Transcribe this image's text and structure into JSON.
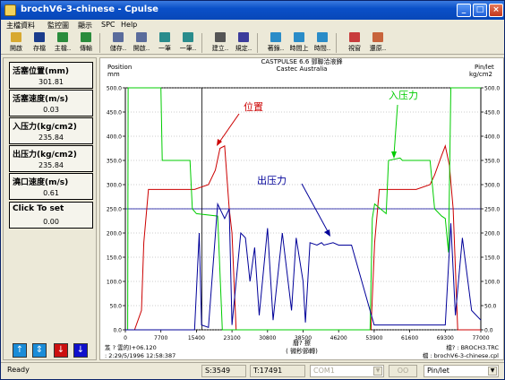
{
  "window": {
    "title": "brochV6-3-chinese - Cpulse",
    "controls": [
      "_",
      "□",
      "×"
    ]
  },
  "menu": [
    "主檔資料",
    "監控圖",
    "顯示",
    "SPC",
    "Help"
  ],
  "toolbar": [
    {
      "label": "開啟",
      "icon": "folder-open-icon",
      "color": "#d8a930"
    },
    {
      "label": "存檔",
      "icon": "floppy-disk-icon",
      "color": "#1a3c8c"
    },
    {
      "label": "主檔..",
      "icon": "database-icon",
      "color": "#2a8c3c"
    },
    {
      "label": "傳輸",
      "icon": "transfer-icon",
      "color": "#2a8c3c"
    },
    {
      "label": "儲存..",
      "icon": "save-icon",
      "color": "#5a6c9c"
    },
    {
      "label": "開啟..",
      "icon": "open-icon",
      "color": "#5a6c9c"
    },
    {
      "label": "一筆",
      "icon": "previous-icon",
      "color": "#2a8c8c"
    },
    {
      "label": "一筆..",
      "icon": "next-icon",
      "color": "#2a8c8c"
    },
    {
      "label": "建立..",
      "icon": "wrench-icon",
      "color": "#555555"
    },
    {
      "label": "規定..",
      "icon": "spec-icon",
      "color": "#3c3c9c"
    },
    {
      "label": "著錄..",
      "icon": "record-icon",
      "color": "#2a8cc8"
    },
    {
      "label": "時間上",
      "icon": "time-up-icon",
      "color": "#2a8cc8"
    },
    {
      "label": "時間..",
      "icon": "time-icon",
      "color": "#2a8cc8"
    },
    {
      "label": "視窗",
      "icon": "window-icon",
      "color": "#c83c3c"
    },
    {
      "label": "還原..",
      "icon": "restore-icon",
      "color": "#c8643c"
    }
  ],
  "values": [
    {
      "label": "活塞位置(mm)",
      "value": "301.81"
    },
    {
      "label": "活塞速度(m/s)",
      "value": "0.03"
    },
    {
      "label": "入压力(kg/cm2)",
      "value": "235.84"
    },
    {
      "label": "出压力(kg/cm2)",
      "value": "235.84"
    },
    {
      "label": "澆口速度(m/s)",
      "value": "0.61"
    },
    {
      "label": "Click To set",
      "value": "0.00"
    }
  ],
  "chart": {
    "header_line1": "CASTPULSE 6.6   鄧聯洽液鋒",
    "header_line2": "Castec Australia",
    "left_axis_title1": "Position",
    "left_axis_title2": "mm",
    "right_axis_title1": "Pin/let",
    "right_axis_title2": "kg/cm2",
    "annotation_position": "位置",
    "annotation_in_pressure": "入压力",
    "annotation_out_pressure": "出压力",
    "x_axis_title": "曆? 擦",
    "x_axis_subtitle": "(   微秒節轉)",
    "footer_left1": "笈    ?   雲的)+06.120",
    "footer_left2": ": 2:29/5/1996 12:58:387",
    "footer_right1": "檔? : BROCH3.TRC",
    "footer_right2": "檔    : brochV6-3-chinese.cpl",
    "colors": {
      "position": "#cc0000",
      "in_pressure": "#00cc00",
      "out_pressure": "#000099"
    }
  },
  "chart_data": {
    "type": "line",
    "title": "CASTPULSE 6.6",
    "x_ticks": [
      0,
      7700,
      15400,
      23100,
      30800,
      38500,
      46200,
      53900,
      61600,
      69300,
      77000
    ],
    "y_ticks_left": [
      0,
      50,
      100,
      150,
      200,
      250,
      300,
      350,
      400,
      450,
      500
    ],
    "y_ticks_right": [
      0,
      50,
      100,
      150,
      200,
      250,
      300,
      350,
      400,
      450,
      500
    ],
    "xlim": [
      0,
      77000
    ],
    "ylim": [
      0,
      500
    ],
    "series": [
      {
        "color": "#cc0000",
        "x": [
          0,
          2000,
          3500,
          4000,
          5000,
          7700,
          10000,
          15000,
          18000,
          19500,
          20500,
          21500,
          22500,
          23100,
          24000,
          30800,
          46200,
          52000,
          53200,
          54000,
          55000,
          58000,
          63000,
          66000,
          67000,
          68500,
          69300,
          70200,
          71000,
          72000,
          77000
        ],
        "values": [
          0,
          0,
          40,
          180,
          290,
          290,
          290,
          290,
          300,
          330,
          375,
          380,
          250,
          200,
          0,
          0,
          0,
          0,
          0,
          180,
          290,
          290,
          290,
          300,
          320,
          360,
          380,
          340,
          250,
          0,
          0
        ]
      },
      {
        "color": "#00cc00",
        "x": [
          0,
          500,
          600,
          3500,
          5000,
          7700,
          8000,
          14000,
          14500,
          15400,
          20000,
          21000,
          22000,
          23100,
          30800,
          46200,
          53000,
          53500,
          54000,
          56500,
          57000,
          59500,
          60000,
          66000,
          67000,
          68500,
          69300,
          70000,
          70500,
          77000
        ],
        "values": [
          0,
          0,
          500,
          500,
          500,
          500,
          350,
          350,
          250,
          240,
          235,
          0,
          0,
          0,
          0,
          0,
          0,
          230,
          260,
          240,
          350,
          355,
          350,
          350,
          250,
          235,
          230,
          160,
          500,
          500
        ]
      },
      {
        "color": "#000099",
        "x": [
          0,
          7700,
          12000,
          15000,
          16000,
          16500,
          18000,
          20000,
          21500,
          22500,
          23100,
          25000,
          26000,
          27000,
          28000,
          29000,
          30800,
          32000,
          34000,
          36000,
          37000,
          38500,
          39000,
          40000,
          41500,
          42500,
          43000,
          45000,
          46200,
          49000,
          53900,
          61600,
          64000,
          66000,
          68000,
          69300,
          70500,
          71500,
          73000,
          75000,
          77000
        ],
        "values": [
          0,
          0,
          0,
          0,
          200,
          10,
          5,
          260,
          230,
          250,
          10,
          200,
          190,
          100,
          170,
          30,
          210,
          20,
          200,
          40,
          190,
          100,
          15,
          180,
          175,
          180,
          175,
          180,
          175,
          175,
          10,
          10,
          10,
          10,
          10,
          10,
          220,
          30,
          190,
          40,
          20
        ]
      }
    ]
  },
  "left_buttons": [
    {
      "name": "up-arrow-button",
      "glyph": "↑",
      "color": "#1a8cd8"
    },
    {
      "name": "double-arrow-button",
      "glyph": "⇕",
      "color": "#1a8cd8"
    },
    {
      "name": "down-arrow-red-button",
      "glyph": "↓",
      "color": "#cc1010"
    },
    {
      "name": "down-arrow-blue-button",
      "glyph": "↓",
      "color": "#1010cc"
    }
  ],
  "status": {
    "ready": "Ready",
    "s_field": "S:3549",
    "t_field": "T:17491",
    "com_select": "COM1",
    "ok_button": "OO",
    "unit_select": "Pin/let"
  }
}
